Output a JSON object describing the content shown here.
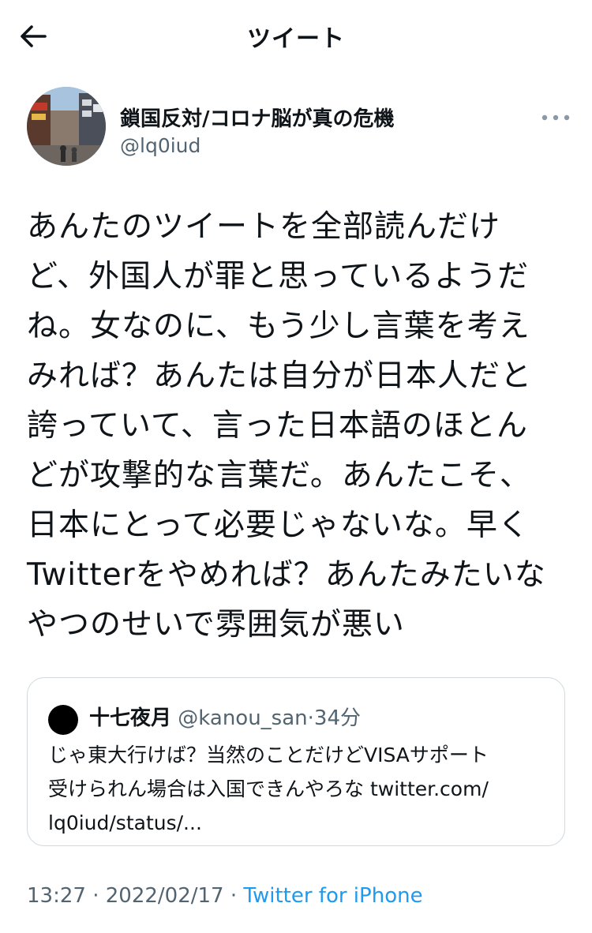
{
  "header": {
    "title": "ツイート",
    "back_icon": "arrow-left-icon"
  },
  "author": {
    "display_name": "鎖国反対/コロナ脳が真の危機",
    "handle": "@lq0iud",
    "more_icon": "ellipsis-icon"
  },
  "tweet": {
    "text": "あんたのツイートを全部読んだけ\nど、外国人が罪と思っているようだ\nね。女なのに、もう少し言葉を考え\nみれば？あんたは自分が日本人だと\n誇っていて、言った日本語のほとん\nどが攻撃的な言葉だ。あんたこそ、\n日本にとって必要じゃないな。早く\nTwitterをやめれば？あんたみたいな\nやつのせいで雰囲気が悪い"
  },
  "quoted_tweet": {
    "name": "十七夜月",
    "handle": "@kanou_san",
    "separator": "·",
    "time": "34分",
    "text": "じゃ東大行けば？当然のことだけどVISAサポート\n受けられん場合は入国できんやろな twitter.com/\nlq0iud/status/..."
  },
  "meta": {
    "time": "13:27",
    "separator": "·",
    "date": "2022/02/17",
    "source": "Twitter for iPhone"
  },
  "colors": {
    "accent": "#1d9bf0",
    "secondary_text": "#536471",
    "border": "#cfd9de"
  }
}
